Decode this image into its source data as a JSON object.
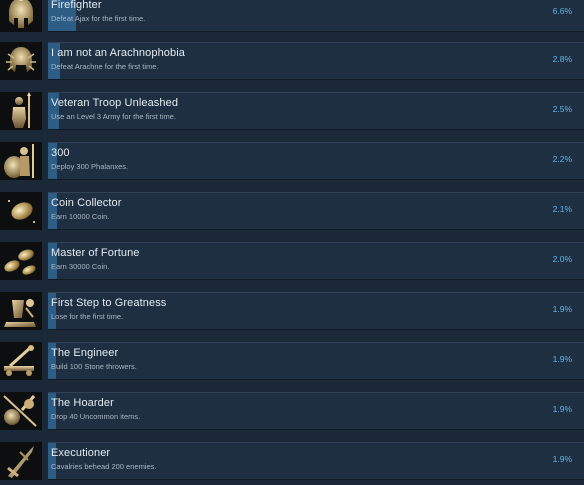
{
  "achievements": [
    {
      "title": "Firefighter",
      "description": "Defeat Ajax for the first time.",
      "percent_text": "6.6%",
      "unlock_percent": 6.6,
      "icon": "helmet-icon"
    },
    {
      "title": "I am not an Arachnophobia",
      "description": "Defeat Arachne for the first time.",
      "percent_text": "2.8%",
      "unlock_percent": 2.8,
      "icon": "spider-helmet-icon"
    },
    {
      "title": "Veteran Troop Unleashed",
      "description": "Use an Level 3 Army for the first time.",
      "percent_text": "2.5%",
      "unlock_percent": 2.5,
      "icon": "soldier-icon"
    },
    {
      "title": "300",
      "description": "Deploy 300 Phalanxes.",
      "percent_text": "2.2%",
      "unlock_percent": 2.2,
      "icon": "phalanx-shield-icon"
    },
    {
      "title": "Coin Collector",
      "description": "Earn 10000 Coin.",
      "percent_text": "2.1%",
      "unlock_percent": 2.1,
      "icon": "coin-icon"
    },
    {
      "title": "Master of Fortune",
      "description": "Earn 30000 Coin.",
      "percent_text": "2.0%",
      "unlock_percent": 2.0,
      "icon": "coins-icon"
    },
    {
      "title": "First Step to Greatness",
      "description": "Lose for the first time.",
      "percent_text": "1.9%",
      "unlock_percent": 1.9,
      "icon": "fallen-warrior-icon"
    },
    {
      "title": "The Engineer",
      "description": "Build 100 Stone throwers.",
      "percent_text": "1.9%",
      "unlock_percent": 1.9,
      "icon": "catapult-icon"
    },
    {
      "title": "The Hoarder",
      "description": "Drop 40 Uncommon items.",
      "percent_text": "1.9%",
      "unlock_percent": 1.9,
      "icon": "weapons-icon"
    },
    {
      "title": "Executioner",
      "description": "Cavalries behead 200 enemies.",
      "percent_text": "1.9%",
      "unlock_percent": 1.9,
      "icon": "sword-icon"
    }
  ]
}
